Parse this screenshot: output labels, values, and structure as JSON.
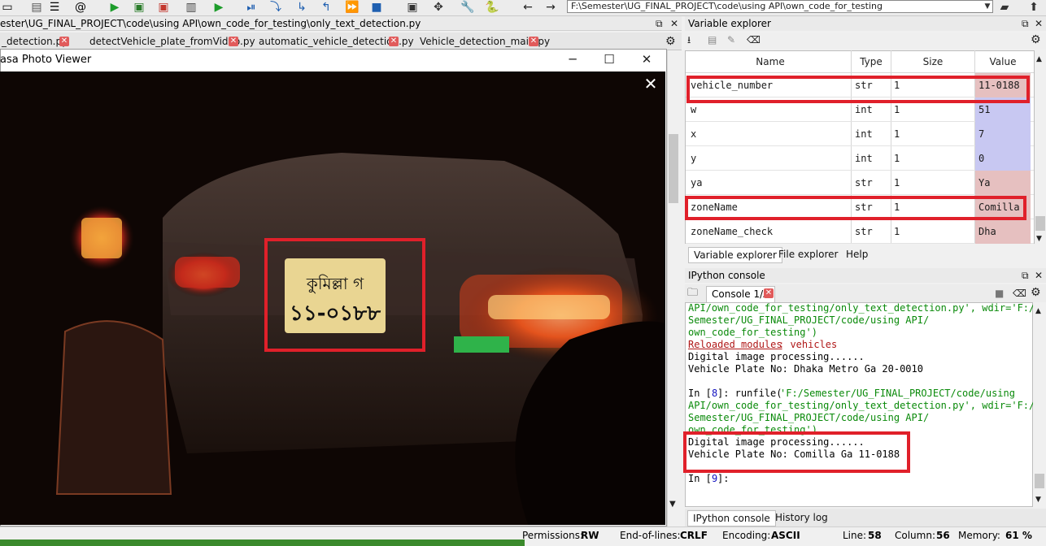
{
  "toolbar": {
    "path": "F:\\Semester\\UG_FINAL_PROJECT\\code\\using API\\own_code_for_testing"
  },
  "editor": {
    "path": "ester\\UG_FINAL_PROJECT\\code\\using API\\own_code_for_testing\\only_text_detection.py",
    "tabs": [
      {
        "label": "_detection.py"
      },
      {
        "label": "detectVehicle_plate_fromVideo.py"
      },
      {
        "label": "automatic_vehicle_detection.py"
      },
      {
        "label": "Vehicle_detection_main.py"
      }
    ]
  },
  "viewer": {
    "title": "asa Photo Viewer",
    "plate_line1": "কুমিল্লা গ",
    "plate_line2": "১১-০১৮৮"
  },
  "variable_explorer": {
    "title": "Variable explorer",
    "columns": [
      "Name",
      "Type",
      "Size",
      "Value"
    ],
    "rows": [
      {
        "name": "vehicle_number",
        "type": "str",
        "size": "1",
        "value": "11-0188"
      },
      {
        "name": "w",
        "type": "int",
        "size": "1",
        "value": "51"
      },
      {
        "name": "x",
        "type": "int",
        "size": "1",
        "value": "7"
      },
      {
        "name": "y",
        "type": "int",
        "size": "1",
        "value": "0"
      },
      {
        "name": "ya",
        "type": "str",
        "size": "1",
        "value": "Ya"
      },
      {
        "name": "zoneName",
        "type": "str",
        "size": "1",
        "value": "Comilla"
      },
      {
        "name": "zoneName_check",
        "type": "str",
        "size": "1",
        "value": "Dha"
      }
    ],
    "tabs": [
      "Variable explorer",
      "File explorer",
      "Help"
    ]
  },
  "console": {
    "title": "IPython console",
    "tab_label": "Console 1/A",
    "lines": [
      "API/own_code_for_testing/only_text_detection.py', wdir='F:/",
      "Semester/UG_FINAL_PROJECT/code/using API/",
      "own_code_for_testing')",
      "Reloaded modules",
      ": vehicles",
      "Digital image processing......",
      "Vehicle Plate No: Dhaka Metro Ga 20-0010",
      "In [",
      "8",
      "]: runfile(",
      "'F:/Semester/UG_FINAL_PROJECT/code/using",
      "API/own_code_for_testing/only_text_detection.py', wdir='F:/",
      "Semester/UG_FINAL_PROJECT/code/using API/",
      "own_code_for_testing')",
      "Digital image processing......",
      "Vehicle Plate No: Comilla Ga 11-0188",
      "9",
      "]:"
    ],
    "bottom_tabs": [
      "IPython console",
      "History log"
    ]
  },
  "statusbar": {
    "permissions_label": "Permissions:",
    "permissions_value": "RW",
    "eol_label": "End-of-lines:",
    "eol_value": "CRLF",
    "encoding_label": "Encoding:",
    "encoding_value": "ASCII",
    "line_label": "Line:",
    "line_value": "58",
    "column_label": "Column:",
    "column_value": "56",
    "memory_label": "Memory:",
    "memory_value": "61 %"
  }
}
